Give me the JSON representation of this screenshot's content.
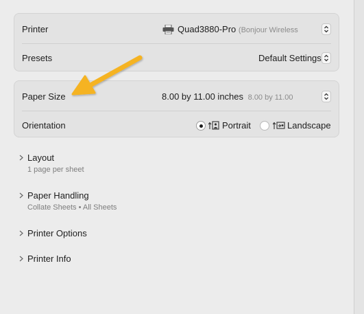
{
  "printer": {
    "label": "Printer",
    "name": "Quad3880-Pro",
    "connection": "(Bonjour Wireless"
  },
  "presets": {
    "label": "Presets",
    "value": "Default Settings"
  },
  "paper_size": {
    "label": "Paper Size",
    "value": "8.00 by 11.00 inches",
    "secondary": "8.00 by 11.00"
  },
  "orientation": {
    "label": "Orientation",
    "options": [
      {
        "label": "Portrait",
        "selected": true
      },
      {
        "label": "Landscape",
        "selected": false
      }
    ]
  },
  "sections": [
    {
      "title": "Layout",
      "summary": "1 page per sheet"
    },
    {
      "title": "Paper Handling",
      "summary": "Collate Sheets • All Sheets"
    },
    {
      "title": "Printer Options",
      "summary": ""
    },
    {
      "title": "Printer Info",
      "summary": ""
    }
  ],
  "colors": {
    "annotation_arrow": "#f5b324"
  }
}
